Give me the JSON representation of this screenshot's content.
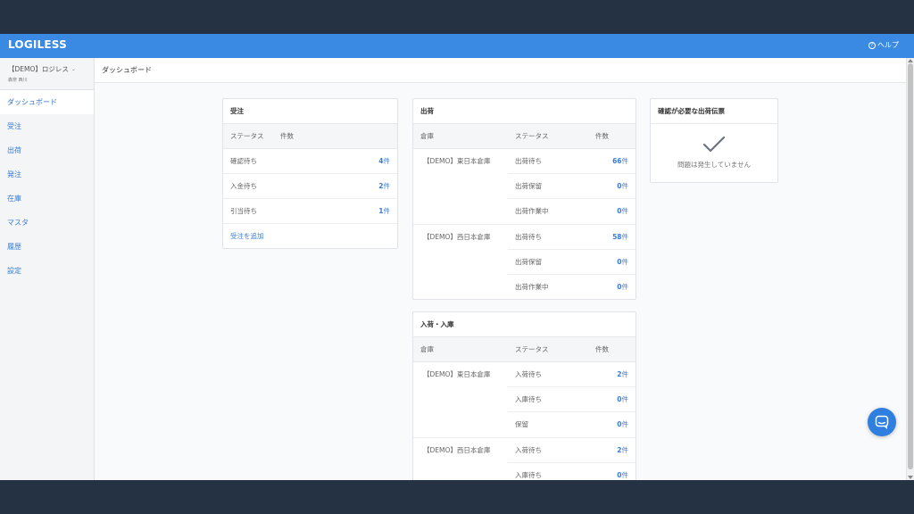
{
  "app": {
    "brand": "LOGILESS",
    "help_label": "ヘルプ"
  },
  "sidebar": {
    "account_name": "【DEMO】ロジレス",
    "account_user": "森奈 西川",
    "items": [
      {
        "label": "ダッシュボード"
      },
      {
        "label": "受注"
      },
      {
        "label": "出荷"
      },
      {
        "label": "発注"
      },
      {
        "label": "在庫"
      },
      {
        "label": "マスタ"
      },
      {
        "label": "履歴"
      },
      {
        "label": "設定"
      }
    ]
  },
  "page": {
    "title": "ダッシュボード"
  },
  "orders": {
    "title": "受注",
    "headers": {
      "status": "ステータス",
      "count": "件数"
    },
    "rows": [
      {
        "status": "確認待ち",
        "count": "4",
        "unit": "件"
      },
      {
        "status": "入金待ち",
        "count": "2",
        "unit": "件"
      },
      {
        "status": "引当待ち",
        "count": "1",
        "unit": "件"
      }
    ],
    "add_link": "受注を追加"
  },
  "shipping": {
    "title": "出荷",
    "headers": {
      "warehouse": "倉庫",
      "status": "ステータス",
      "count": "件数"
    },
    "groups": [
      {
        "warehouse": "【DEMO】東日本倉庫",
        "rows": [
          {
            "status": "出荷待ち",
            "count": "66",
            "unit": "件"
          },
          {
            "status": "出荷保留",
            "count": "0",
            "unit": "件"
          },
          {
            "status": "出荷作業中",
            "count": "0",
            "unit": "件"
          }
        ]
      },
      {
        "warehouse": "【DEMO】西日本倉庫",
        "rows": [
          {
            "status": "出荷待ち",
            "count": "58",
            "unit": "件"
          },
          {
            "status": "出荷保留",
            "count": "0",
            "unit": "件"
          },
          {
            "status": "出荷作業中",
            "count": "0",
            "unit": "件"
          }
        ]
      }
    ]
  },
  "receiving": {
    "title": "入荷・入庫",
    "headers": {
      "warehouse": "倉庫",
      "status": "ステータス",
      "count": "件数"
    },
    "groups": [
      {
        "warehouse": "【DEMO】東日本倉庫",
        "rows": [
          {
            "status": "入荷待ち",
            "count": "2",
            "unit": "件"
          },
          {
            "status": "入庫待ち",
            "count": "0",
            "unit": "件"
          },
          {
            "status": "保留",
            "count": "0",
            "unit": "件"
          }
        ]
      },
      {
        "warehouse": "【DEMO】西日本倉庫",
        "rows": [
          {
            "status": "入荷待ち",
            "count": "2",
            "unit": "件"
          },
          {
            "status": "入庫待ち",
            "count": "0",
            "unit": "件"
          }
        ]
      }
    ]
  },
  "alerts": {
    "title": "確認が必要な出荷伝票",
    "message": "問題は発生していません",
    "icon": "check-icon"
  },
  "colors": {
    "brand": "#3a8ae3",
    "link": "#3a7bd5",
    "frame": "#243244",
    "chat": "#2f7fe0"
  },
  "chat": {
    "icon": "chat-icon"
  }
}
